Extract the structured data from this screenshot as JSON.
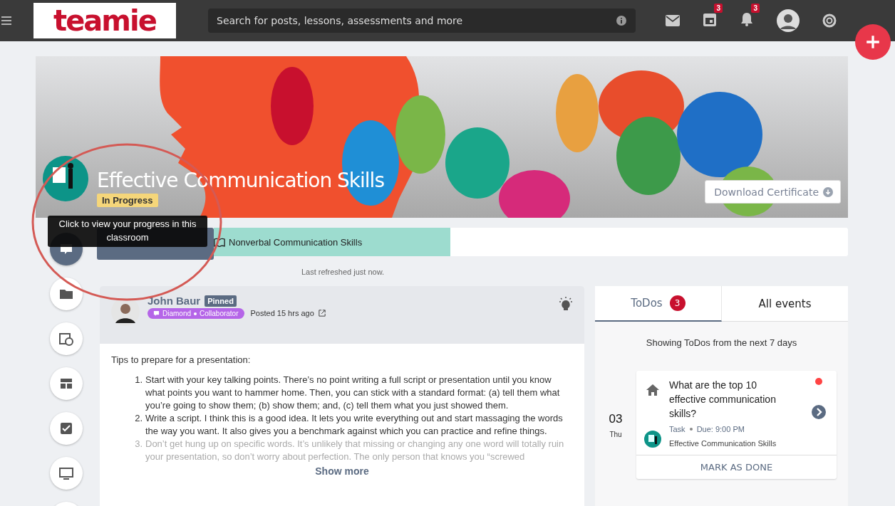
{
  "top_bar": {
    "logo": "teamie",
    "search": {
      "placeholder": "Search for posts, lessons, assessments and more"
    },
    "calendar_badge": "3",
    "notifications_badge": "3"
  },
  "course": {
    "title": "Effective Communication Skills",
    "status": "In Progress",
    "tooltip": "Click to view your progress in this classroom",
    "download_button": "Download Certificate",
    "currently_reading": "Nonverbal Communication Skills",
    "last_refreshed": "Last refreshed just now."
  },
  "post": {
    "author": "John Baur",
    "pinned": "Pinned",
    "badges": [
      "Diamond",
      "Collaborator"
    ],
    "posted": "Posted 15 hrs ago",
    "intro": "Tips to prepare for a presentation:",
    "items": [
      {
        "number": "1.",
        "text": "Start with your key talking points. There’s no point writing a full script or presentation until you know what points you want to hammer home. Then, you can stick with a standard format: (a) tell them what you’re going to show them; (b) show them; and, (c) tell them what you just showed them.",
        "faded": false
      },
      {
        "number": "2.",
        "text": "Write a script. I think this is a good idea. It lets you write everything out and start massaging the words the way you want. It also gives you a benchmark against which you can practice and refine things.",
        "faded": false
      },
      {
        "number": "3.",
        "text": "Don’t get hung up on specific words. It’s unlikely that missing or changing any one word will totally ruin your presentation, so don’t worry about perfection. The only person that knows you “screwed",
        "faded": true
      }
    ],
    "show_more": "Show more"
  },
  "todos": {
    "tabs": [
      {
        "label": "ToDos",
        "count": "3",
        "selected": true
      },
      {
        "label": "All events",
        "selected": false
      }
    ],
    "caption": "Showing ToDos from the next 7 days",
    "items": [
      {
        "day": "03",
        "weekday": "Thu",
        "title": "What are the top 10 effective communication skills?",
        "type": "Task",
        "due": "Due: 9:00 PM",
        "course": "Effective Communication Skills",
        "unread": true,
        "action": "MARK AS DONE"
      }
    ]
  }
}
